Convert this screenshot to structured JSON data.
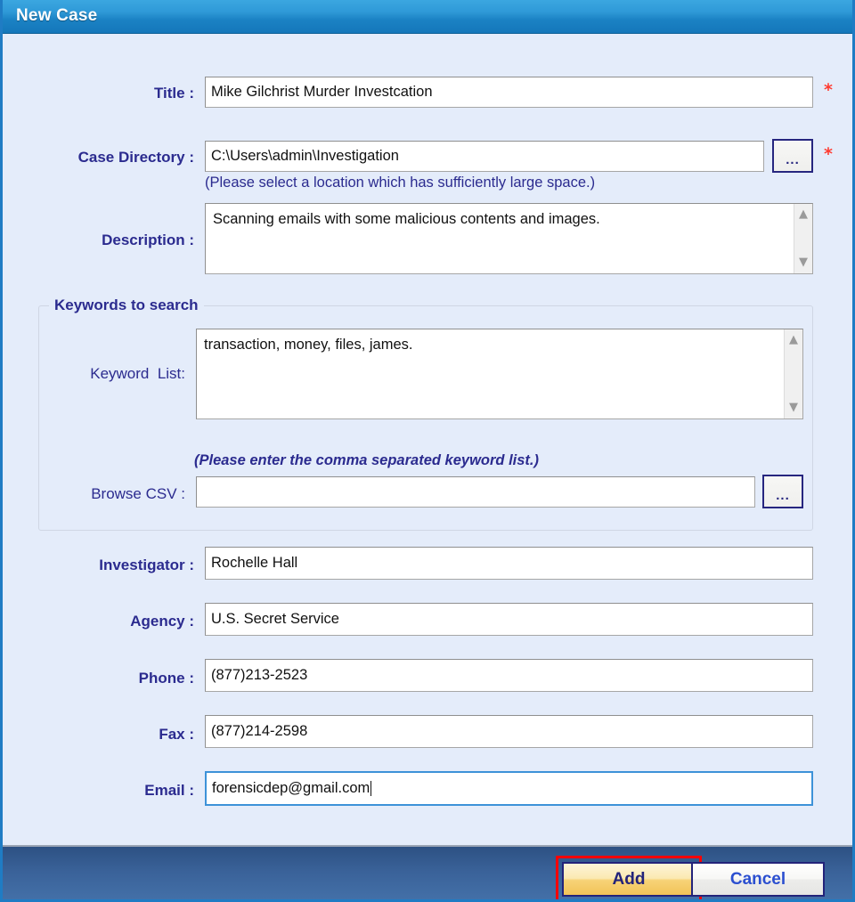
{
  "window": {
    "title": "New Case",
    "accent_title_bar": "#1b82c4",
    "background": "#e4ecfa",
    "footer_color": "#3a6299",
    "label_color": "#2b2b8f",
    "required_marker_color": "#ff3b30",
    "highlight_color": "#ff0000"
  },
  "fields": {
    "title": {
      "label": "Title :",
      "value": "Mike Gilchrist Murder Investcation",
      "placeholder": "",
      "required_marker": "*"
    },
    "case_directory": {
      "label": "Case Directory :",
      "value": "C:\\Users\\admin\\Investigation",
      "placeholder": "",
      "required_marker": "*",
      "browse_label": "...",
      "hint": "(Please select a location which has sufficiently large space.)"
    },
    "description": {
      "label": "Description :",
      "value": "Scanning emails with some malicious contents and images.",
      "placeholder": "",
      "scroll_up_icon": "chevron-up-icon",
      "scroll_down_icon": "chevron-down-icon"
    },
    "investigator": {
      "label": "Investigator :",
      "value": "Rochelle Hall",
      "placeholder": ""
    },
    "agency": {
      "label": "Agency :",
      "value": "U.S. Secret Service",
      "placeholder": ""
    },
    "phone": {
      "label": "Phone :",
      "value": "(877)213-2523",
      "placeholder": ""
    },
    "fax": {
      "label": "Fax :",
      "value": "(877)214-2598",
      "placeholder": ""
    },
    "email": {
      "label": "Email :",
      "value": "forensicdep@gmail.com",
      "placeholder": "",
      "focused": true
    }
  },
  "keywords_group": {
    "title": "Keywords to search",
    "keyword_list": {
      "label": "Keyword  List:",
      "value": "transaction, money, files, james.",
      "placeholder": "",
      "scroll_up_icon": "chevron-up-icon",
      "scroll_down_icon": "chevron-down-icon"
    },
    "hint": "(Please enter the comma separated keyword list.)",
    "browse_csv": {
      "label": "Browse CSV :",
      "value": "",
      "placeholder": "",
      "browse_label": "..."
    }
  },
  "footer": {
    "add_label": "Add",
    "cancel_label": "Cancel"
  }
}
